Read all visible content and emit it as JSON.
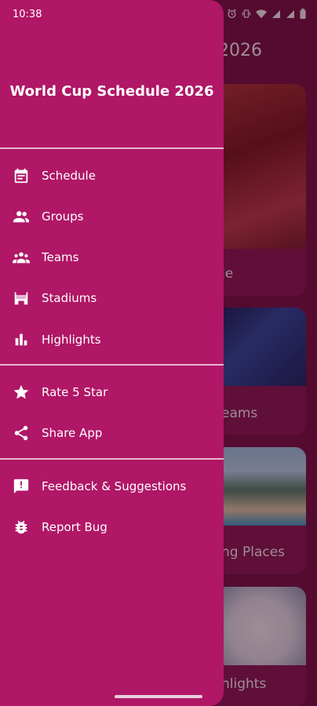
{
  "status_bar": {
    "time": "10:38"
  },
  "background": {
    "title": "2026",
    "cards": [
      {
        "label": "le"
      },
      {
        "label": "eams"
      },
      {
        "label": "ng Places"
      },
      {
        "label": "hlights"
      }
    ]
  },
  "drawer": {
    "title": "World Cup Schedule 2026",
    "items": [
      {
        "label": "Schedule",
        "icon": "calendar-icon"
      },
      {
        "label": "Groups",
        "icon": "group-icon"
      },
      {
        "label": "Teams",
        "icon": "teams-icon"
      },
      {
        "label": "Stadiums",
        "icon": "stadium-icon"
      },
      {
        "label": "Highlights",
        "icon": "bar-chart-icon"
      },
      {
        "label": "Rate 5 Star",
        "icon": "star-icon"
      },
      {
        "label": "Share App",
        "icon": "share-icon"
      },
      {
        "label": "Feedback & Suggestions",
        "icon": "feedback-icon"
      },
      {
        "label": "Report Bug",
        "icon": "bug-icon"
      }
    ]
  },
  "colors": {
    "drawer_bg": "#b01766",
    "divider": "#e8b6cf",
    "text": "#ffffff"
  }
}
